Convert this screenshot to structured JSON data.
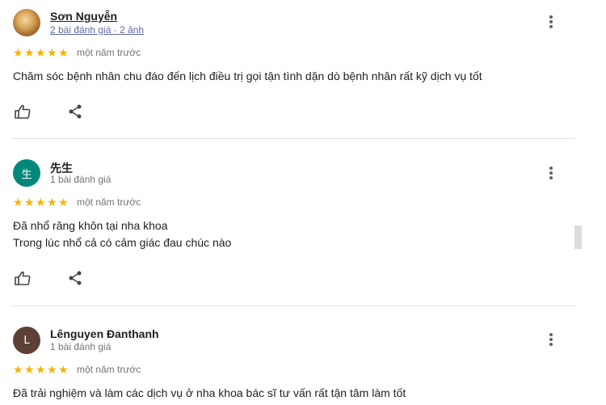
{
  "reviews": [
    {
      "name": "Sơn Nguyễn",
      "review_count": "2 bài đánh giá",
      "sep": " · ",
      "photo_count": "2 ảnh",
      "rating": 5,
      "time": "một năm trước",
      "text_lines": [
        "Chăm sóc bệnh nhân chu đáo đến lịch điều trị gọi tận tình dặn dò bệnh nhân rất kỹ dịch vụ tốt"
      ]
    },
    {
      "name": "先生",
      "avatar_letter": "生",
      "avatar_color": "#00897b",
      "review_count": "1 bài đánh giá",
      "rating": 5,
      "time": "một năm trước",
      "text_lines": [
        "Đã nhổ răng khôn tại nha khoa",
        "Trong lúc nhổ cả có cảm giác đau chúc nào"
      ]
    },
    {
      "name": "Lênguyen Đanthanh",
      "avatar_letter": "L",
      "avatar_color": "#5d4037",
      "review_count": "1 bài đánh giá",
      "rating": 5,
      "time": "một năm trước",
      "text_lines": [
        "Đã trải nghiệm và làm các dịch vụ ở nha khoa bác sĩ tư vấn rất tận tâm làm tốt"
      ]
    }
  ],
  "icons": {
    "more": "more-vert-icon",
    "like": "thumb-up-icon",
    "share": "share-icon",
    "star": "star-icon"
  },
  "colors": {
    "star": "#f4b400",
    "text": "#202124",
    "muted": "#70757a",
    "divider": "#e0e0e0"
  }
}
